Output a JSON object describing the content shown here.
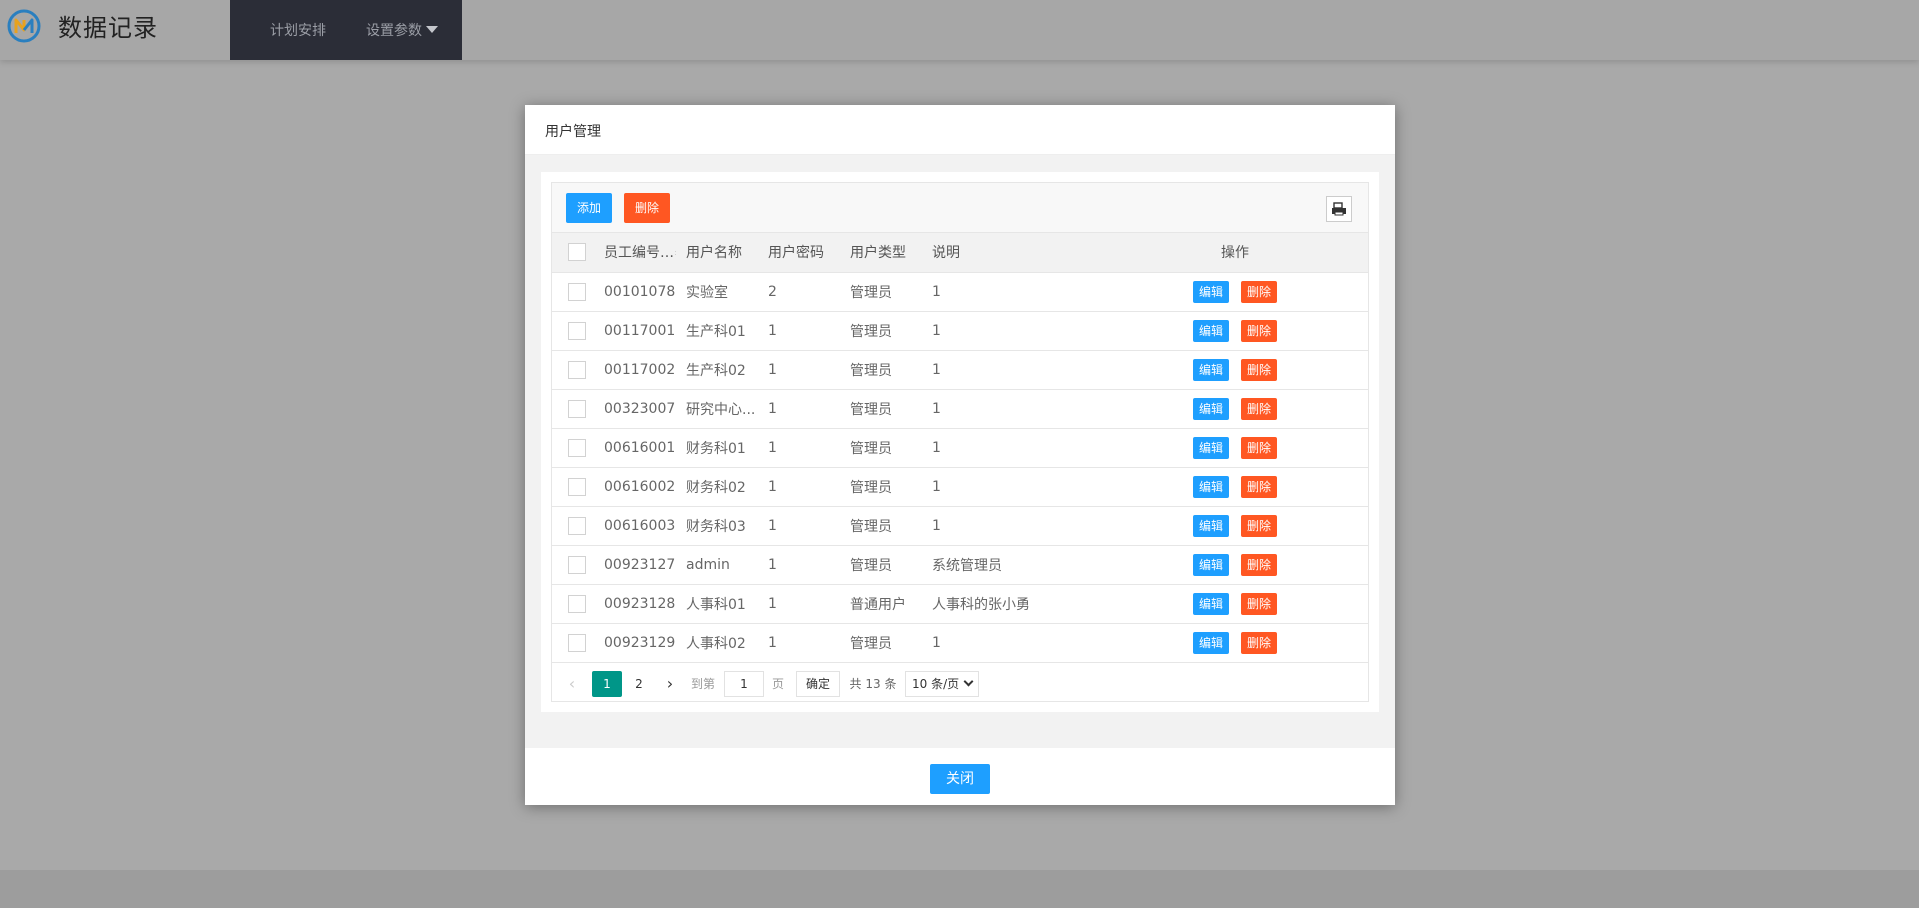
{
  "header": {
    "app_title": "数据记录",
    "nav": [
      {
        "label": "计划安排"
      },
      {
        "label": "设置参数"
      }
    ]
  },
  "modal": {
    "title": "用户管理",
    "toolbar": {
      "add_label": "添加",
      "delete_label": "删除",
      "export_icon": "printer-icon"
    },
    "columns": [
      "员工编号...",
      "用户名称",
      "用户密码",
      "用户类型",
      "说明",
      "操作"
    ],
    "rows": [
      {
        "id": "00101078",
        "name": "实验室",
        "password": "2",
        "type": "管理员",
        "note": "1"
      },
      {
        "id": "00117001",
        "name": "生产科01",
        "password": "1",
        "type": "管理员",
        "note": "1"
      },
      {
        "id": "00117002",
        "name": "生产科02",
        "password": "1",
        "type": "管理员",
        "note": "1"
      },
      {
        "id": "00323007",
        "name": "研究中心...",
        "password": "1",
        "type": "管理员",
        "note": "1"
      },
      {
        "id": "00616001",
        "name": "财务科01",
        "password": "1",
        "type": "管理员",
        "note": "1"
      },
      {
        "id": "00616002",
        "name": "财务科02",
        "password": "1",
        "type": "管理员",
        "note": "1"
      },
      {
        "id": "00616003",
        "name": "财务科03",
        "password": "1",
        "type": "管理员",
        "note": "1"
      },
      {
        "id": "00923127",
        "name": "admin",
        "password": "1",
        "type": "管理员",
        "note": "系统管理员"
      },
      {
        "id": "00923128",
        "name": "人事科01",
        "password": "1",
        "type": "普通用户",
        "note": "人事科的张小勇"
      },
      {
        "id": "00923129",
        "name": "人事科02",
        "password": "1",
        "type": "管理员",
        "note": "1"
      }
    ],
    "row_actions": {
      "edit": "编辑",
      "delete": "删除"
    },
    "pager": {
      "pages": [
        "1",
        "2"
      ],
      "current": "1",
      "goto_label": "到第",
      "goto_value": "1",
      "page_label": "页",
      "confirm_label": "确定",
      "total_label": "共 13 条",
      "page_size": "10 条/页"
    },
    "close_label": "关闭"
  },
  "colors": {
    "blue": "#1e9fff",
    "orange": "#ff5722",
    "teal": "#009688",
    "nav_bg": "#2b2d37"
  }
}
